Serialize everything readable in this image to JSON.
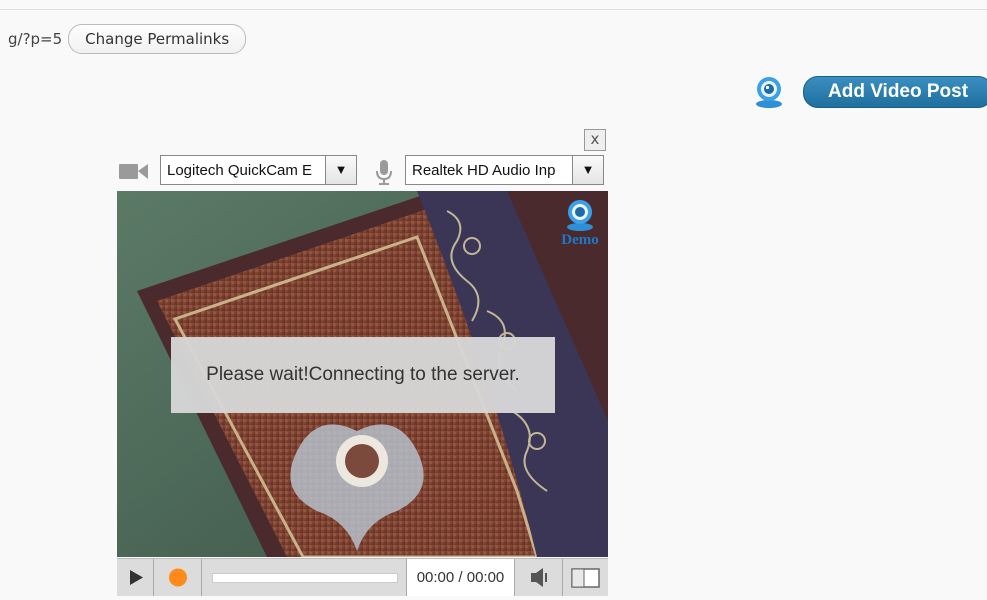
{
  "permalink": {
    "url_fragment": "g/?p=5",
    "change_button_label": "Change Permalinks"
  },
  "header": {
    "add_video_post_label": "Add Video Post",
    "webcam_icon": "webcam-icon"
  },
  "recorder": {
    "close_label": "x",
    "camera_select": "Logitech QuickCam E",
    "audio_select": "Realtek HD Audio Inp",
    "demo_badge": "Demo",
    "status_message": "Please wait!Connecting to the server.",
    "time_display": "00:00 / 00:00",
    "progress": 0
  },
  "colors": {
    "accent_blue": "#2a7db0",
    "record_orange": "#ff8a1c"
  }
}
